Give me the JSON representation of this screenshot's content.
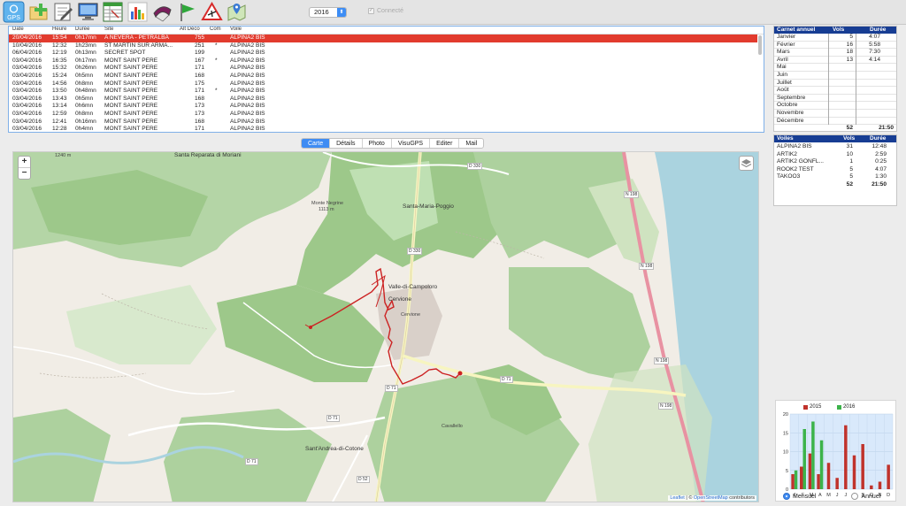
{
  "toolbar": {
    "buttons": [
      {
        "name": "gps",
        "label": "GPS",
        "icon": "gps-icon"
      },
      {
        "name": "add-flight",
        "icon": "add-folder-icon"
      },
      {
        "name": "edit",
        "icon": "edit-notepad-icon"
      },
      {
        "name": "display",
        "icon": "monitor-icon"
      },
      {
        "name": "logbook",
        "icon": "spreadsheet-icon"
      },
      {
        "name": "statistics",
        "icon": "bar-chart-icon"
      },
      {
        "name": "wing",
        "icon": "paraglider-wing-icon"
      },
      {
        "name": "sites",
        "icon": "green-flag-icon"
      },
      {
        "name": "airspace",
        "icon": "warning-plane-icon"
      },
      {
        "name": "map-pin",
        "icon": "map-pin-icon"
      }
    ],
    "year": "2016",
    "connect_label": "Connecté"
  },
  "flights_table": {
    "columns": [
      "Date",
      "Heure",
      "Durée",
      "Site",
      "Alt Déco",
      "Com",
      "Voile"
    ],
    "rows": [
      {
        "date": "20/04/2016",
        "time": "15:54",
        "duration": "0h17mn",
        "site": "A NEVERA - PETRALBA",
        "alt": "755",
        "com": "",
        "wing": "ALPINA2 BIS",
        "selected": true
      },
      {
        "date": "10/04/2016",
        "time": "12:32",
        "duration": "1h23mn",
        "site": "ST MARTIN SUR ARMA...",
        "alt": "251",
        "com": "*",
        "wing": "ALPINA2 BIS"
      },
      {
        "date": "06/04/2016",
        "time": "12:19",
        "duration": "0h13mn",
        "site": "SECRET SPOT",
        "alt": "199",
        "com": "",
        "wing": "ALPINA2 BIS"
      },
      {
        "date": "03/04/2016",
        "time": "16:35",
        "duration": "0h17mn",
        "site": "MONT SAINT PERE",
        "alt": "167",
        "com": "*",
        "wing": "ALPINA2 BIS"
      },
      {
        "date": "03/04/2016",
        "time": "15:32",
        "duration": "0h26mn",
        "site": "MONT SAINT PERE",
        "alt": "171",
        "com": "",
        "wing": "ALPINA2 BIS"
      },
      {
        "date": "03/04/2016",
        "time": "15:24",
        "duration": "0h5mn",
        "site": "MONT SAINT PERE",
        "alt": "168",
        "com": "",
        "wing": "ALPINA2 BIS"
      },
      {
        "date": "03/04/2016",
        "time": "14:56",
        "duration": "0h8mn",
        "site": "MONT SAINT PERE",
        "alt": "175",
        "com": "",
        "wing": "ALPINA2 BIS"
      },
      {
        "date": "03/04/2016",
        "time": "13:50",
        "duration": "0h48mn",
        "site": "MONT SAINT PERE",
        "alt": "171",
        "com": "*",
        "wing": "ALPINA2 BIS"
      },
      {
        "date": "03/04/2016",
        "time": "13:43",
        "duration": "0h5mn",
        "site": "MONT SAINT PERE",
        "alt": "168",
        "com": "",
        "wing": "ALPINA2 BIS"
      },
      {
        "date": "03/04/2016",
        "time": "13:14",
        "duration": "0h6mn",
        "site": "MONT SAINT PERE",
        "alt": "173",
        "com": "",
        "wing": "ALPINA2 BIS"
      },
      {
        "date": "03/04/2016",
        "time": "12:59",
        "duration": "0h8mn",
        "site": "MONT SAINT PERE",
        "alt": "173",
        "com": "",
        "wing": "ALPINA2 BIS"
      },
      {
        "date": "03/04/2016",
        "time": "12:41",
        "duration": "0h16mn",
        "site": "MONT SAINT PERE",
        "alt": "168",
        "com": "",
        "wing": "ALPINA2 BIS"
      },
      {
        "date": "03/04/2016",
        "time": "12:28",
        "duration": "0h4mn",
        "site": "MONT SAINT PERE",
        "alt": "171",
        "com": "",
        "wing": "ALPINA2 BIS"
      }
    ]
  },
  "tabs": [
    "Carte",
    "Détails",
    "Photo",
    "VisuGPS",
    "Editer",
    "Mail"
  ],
  "active_tab": "Carte",
  "map": {
    "zoom_in": "+",
    "zoom_out": "−",
    "attribution_leaflet": "Leaflet",
    "attribution_sep": " | © ",
    "attribution_osm": "OpenStreetMap",
    "attribution_tail": " contributors",
    "labels": [
      {
        "text": "Santa Reparata di Moriani",
        "cls": "big"
      },
      {
        "text": "Monte Negrine",
        "cls": ""
      },
      {
        "text": "1113 m",
        "cls": ""
      },
      {
        "text": "Santa-Maria-Poggio",
        "cls": "big"
      },
      {
        "text": "Valle-di-Campoloro",
        "cls": "big"
      },
      {
        "text": "Cervione",
        "cls": "big"
      },
      {
        "text": "Cervione",
        "cls": ""
      },
      {
        "text": "Sant'Andrea-di-Cotone",
        "cls": "big"
      },
      {
        "text": "Cavallello",
        "cls": ""
      },
      {
        "text": "1240 m",
        "cls": ""
      }
    ],
    "roads": [
      "D 330",
      "D 330",
      "N 198",
      "N 198",
      "N 198",
      "N 198",
      "D 71",
      "D 71",
      "D 71",
      "D 71",
      "D 52"
    ]
  },
  "carnet_annuel": {
    "title": "Carnet annuel",
    "col_vols": "Vols",
    "col_duree": "Durée",
    "months": [
      {
        "name": "Janvier",
        "vols": "5",
        "duree": "4:07"
      },
      {
        "name": "Février",
        "vols": "16",
        "duree": "5:58"
      },
      {
        "name": "Mars",
        "vols": "18",
        "duree": "7:30"
      },
      {
        "name": "Avril",
        "vols": "13",
        "duree": "4:14"
      },
      {
        "name": "Mai",
        "vols": "",
        "duree": ""
      },
      {
        "name": "Juin",
        "vols": "",
        "duree": ""
      },
      {
        "name": "Juillet",
        "vols": "",
        "duree": ""
      },
      {
        "name": "Août",
        "vols": "",
        "duree": ""
      },
      {
        "name": "Septembre",
        "vols": "",
        "duree": ""
      },
      {
        "name": "Octobre",
        "vols": "",
        "duree": ""
      },
      {
        "name": "Novembre",
        "vols": "",
        "duree": ""
      },
      {
        "name": "Décembre",
        "vols": "",
        "duree": ""
      }
    ],
    "total_vols": "52",
    "total_duree": "21:50"
  },
  "voiles": {
    "title": "Voiles",
    "col_vols": "Vols",
    "col_duree": "Durée",
    "rows": [
      {
        "name": "ALPINA2 BIS",
        "vols": "31",
        "duree": "12:48"
      },
      {
        "name": "ARTIK2",
        "vols": "10",
        "duree": "2:59"
      },
      {
        "name": "ARTIK2 GONFL...",
        "vols": "1",
        "duree": "0:25"
      },
      {
        "name": "ROOK2 TEST",
        "vols": "5",
        "duree": "4:07"
      },
      {
        "name": "TAKOO3",
        "vols": "5",
        "duree": "1:30"
      }
    ],
    "total_vols": "52",
    "total_duree": "21:50"
  },
  "chart_data": {
    "type": "bar",
    "categories": [
      "J",
      "F",
      "M",
      "A",
      "M",
      "J",
      "J",
      "A",
      "S",
      "O",
      "N",
      "D"
    ],
    "series": [
      {
        "name": "2015",
        "color": "#c0322b",
        "values": [
          4,
          6,
          9.5,
          4,
          7,
          3,
          17,
          9,
          12,
          1,
          2,
          6.5
        ]
      },
      {
        "name": "2016",
        "color": "#3cb34a",
        "values": [
          5,
          16,
          18,
          13,
          0,
          0,
          0,
          0,
          0,
          0,
          0,
          0
        ]
      }
    ],
    "ylim": [
      0,
      20
    ],
    "yticks": [
      "0",
      "5",
      "10",
      "15",
      "20"
    ],
    "grid": true,
    "legend": "top"
  },
  "view_mode": {
    "options": [
      "Mensuel",
      "Annuel"
    ],
    "selected": "Mensuel"
  }
}
